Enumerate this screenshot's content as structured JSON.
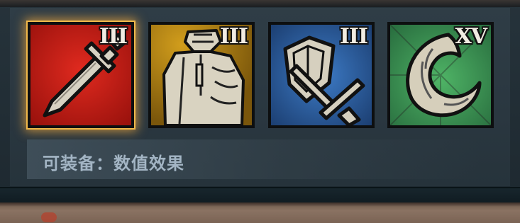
{
  "cards": [
    {
      "name": "sword",
      "rank": "III",
      "color": "#c8201a",
      "selected": true
    },
    {
      "name": "armor",
      "rank": "III",
      "color": "#b78412",
      "selected": false
    },
    {
      "name": "shield-sword",
      "rank": "III",
      "color": "#2e64a8",
      "selected": false
    },
    {
      "name": "crescent",
      "rank": "XV",
      "color": "#3f9a54",
      "selected": false
    }
  ],
  "caption": {
    "text": "可装备：数值效果"
  },
  "colors": {
    "highlight": "#f0b84a",
    "caption_text": "#a3b5c4"
  }
}
